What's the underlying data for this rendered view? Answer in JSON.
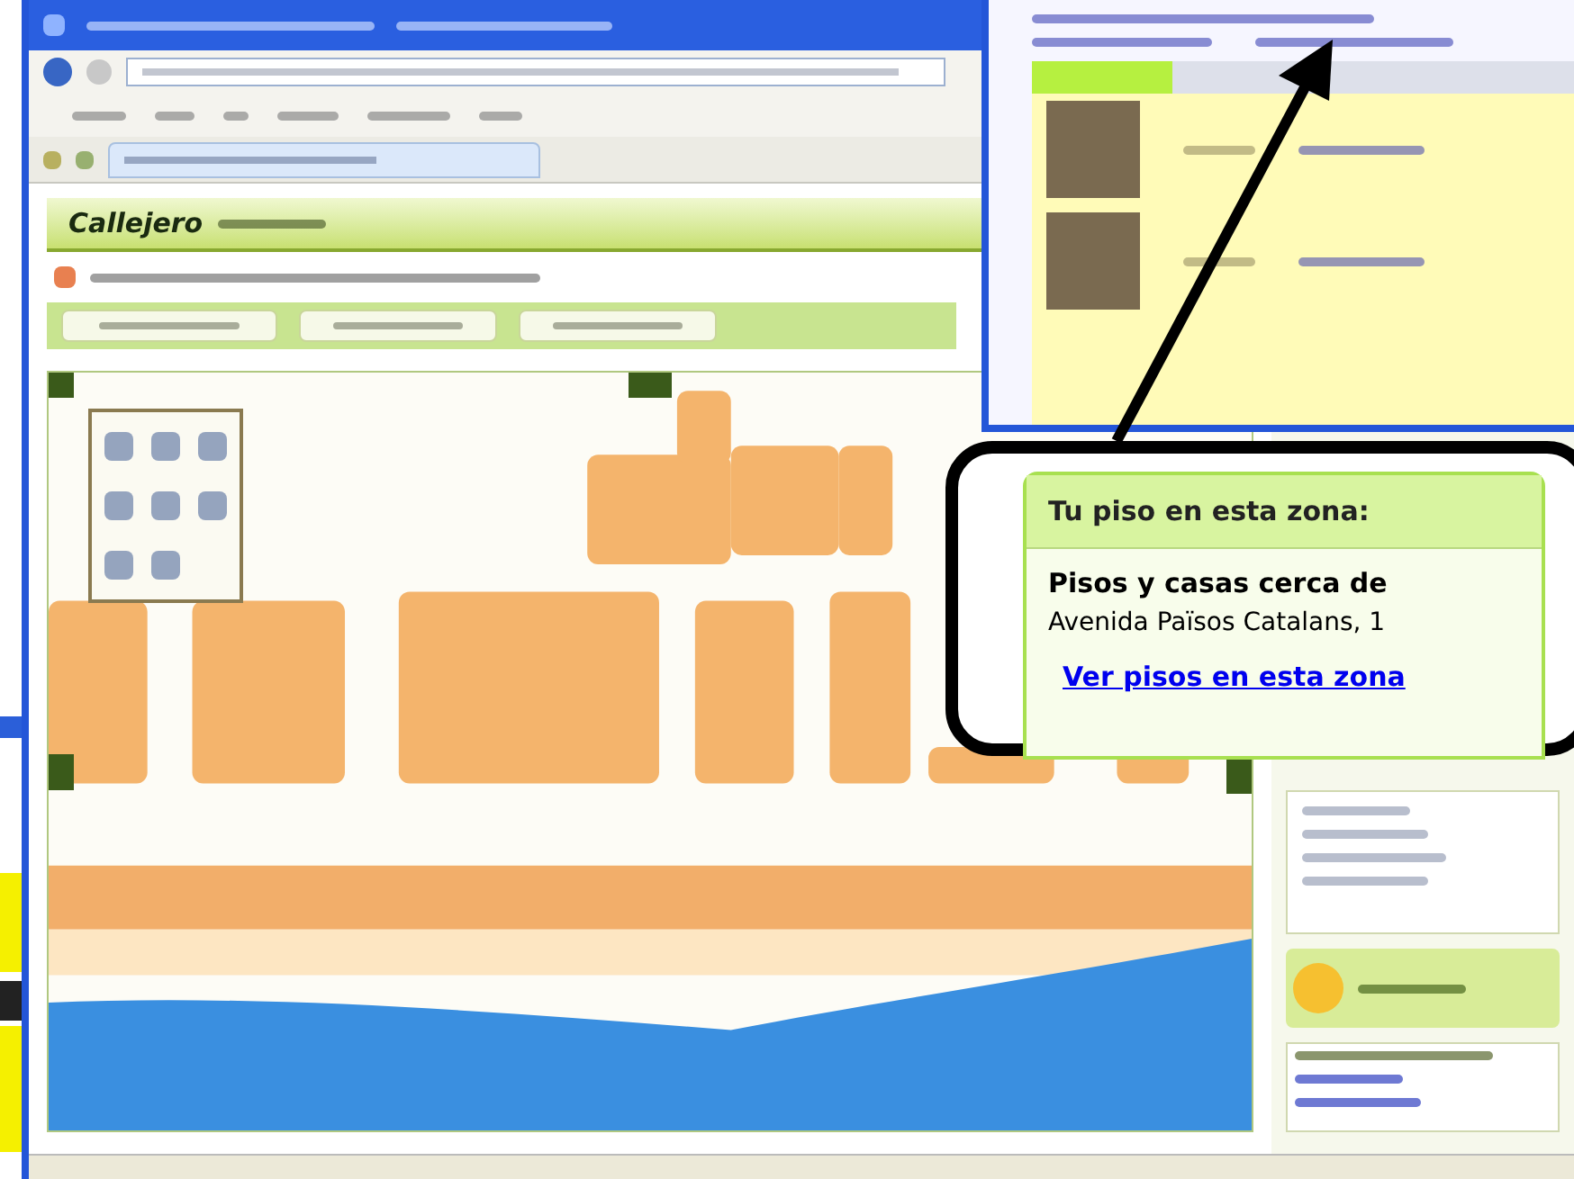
{
  "browser": {
    "logo": "Callejero"
  },
  "callout": {
    "title": "Tu piso en esta zona:",
    "heading": "Pisos y casas cerca de",
    "address": "Avenida Països Catalans, 1",
    "link": "Ver pisos en esta zona"
  }
}
